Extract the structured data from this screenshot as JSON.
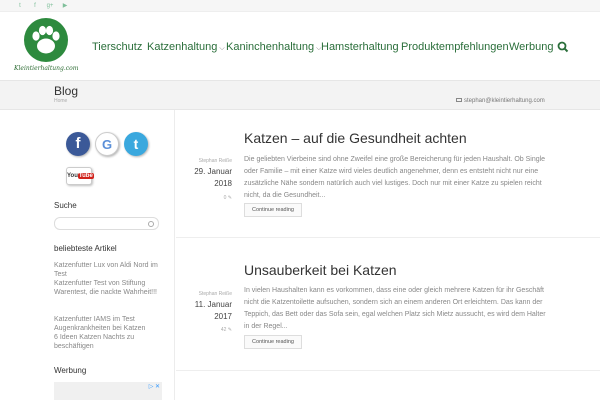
{
  "topbar": {
    "social": [
      {
        "icon": "twitter-icon",
        "glyph": "t"
      },
      {
        "icon": "facebook-icon",
        "glyph": "f"
      },
      {
        "icon": "google-plus-icon",
        "glyph": "g+"
      },
      {
        "icon": "youtube-icon",
        "glyph": "▶"
      }
    ]
  },
  "logo": {
    "text": "Kleintierhaltung.com",
    "icon": "paw-icon",
    "color": "#2d8a3e"
  },
  "nav": {
    "items": [
      {
        "label": "Tierschutz"
      },
      {
        "label": "Katzenhaltung",
        "dropdown": true
      },
      {
        "label": "Kaninchenhaltung",
        "dropdown": true
      },
      {
        "label": "Hamsterhaltung"
      },
      {
        "label": "Produktempfehlungen"
      },
      {
        "label": "Werbung"
      }
    ],
    "chevron": "⌵",
    "search_icon": "search-icon",
    "color": "#2a6e3a"
  },
  "titleband": {
    "title": "Blog",
    "breadcrumb": "Home",
    "contact_email": "stephan@kleintierhaltung.com"
  },
  "sidebar": {
    "social_buttons": [
      {
        "icon": "facebook-icon",
        "glyph": "f",
        "color": "#3b5998"
      },
      {
        "icon": "google-icon",
        "glyph": "G",
        "color": "#5a8fd8"
      },
      {
        "icon": "twitter-icon",
        "glyph": "t",
        "color": "#3aa8de"
      }
    ],
    "youtube": {
      "you": "You",
      "tube": "Tube"
    },
    "search_heading": "Suche",
    "popular_heading": "beliebteste Artikel",
    "popular": [
      "Katzenfutter Lux von Aldi Nord im Test",
      "Katzenfutter Test von Stiftung Warentest, die nackte Wahrheit!!!",
      "Katzenfutter IAMS im Test",
      "Augenkrankheiten bei Katzen",
      "6 Ideen Katzen Nachts zu beschäftigen"
    ],
    "ad_heading": "Werbung"
  },
  "posts": [
    {
      "title": "Katzen – auf die Gesundheit achten",
      "author": "Stephan Reiße",
      "date_line1": "29. Januar",
      "date_line2": "2018",
      "comments": "0",
      "body": "Die geliebten Vierbeine sind ohne Zweifel eine große Bereicherung für jeden Haushalt. Ob Single oder Familie – mit einer Katze wird vieles deutlich angenehmer, denn es entsteht nicht nur eine zusätzliche Nähe sondern natürlich auch viel lustiges. Doch nur mit einer Katze zu spielen reicht nicht, da die Gesundheit...",
      "more": "Continue reading"
    },
    {
      "title": "Unsauberkeit bei Katzen",
      "author": "Stephan Reiße",
      "date_line1": "11. Januar",
      "date_line2": "2017",
      "comments": "42",
      "body": "In vielen Haushalten kann es vorkommen, dass eine oder gleich mehrere Katzen für ihr Geschäft nicht die Katzentoilette aufsuchen, sondern sich an einem anderen Ort erleichtern. Das kann der Teppich, das Bett oder das Sofa sein, egal welchen Platz sich Mietz aussucht, es wird dem Halter in der Regel...",
      "more": "Continue reading"
    }
  ]
}
